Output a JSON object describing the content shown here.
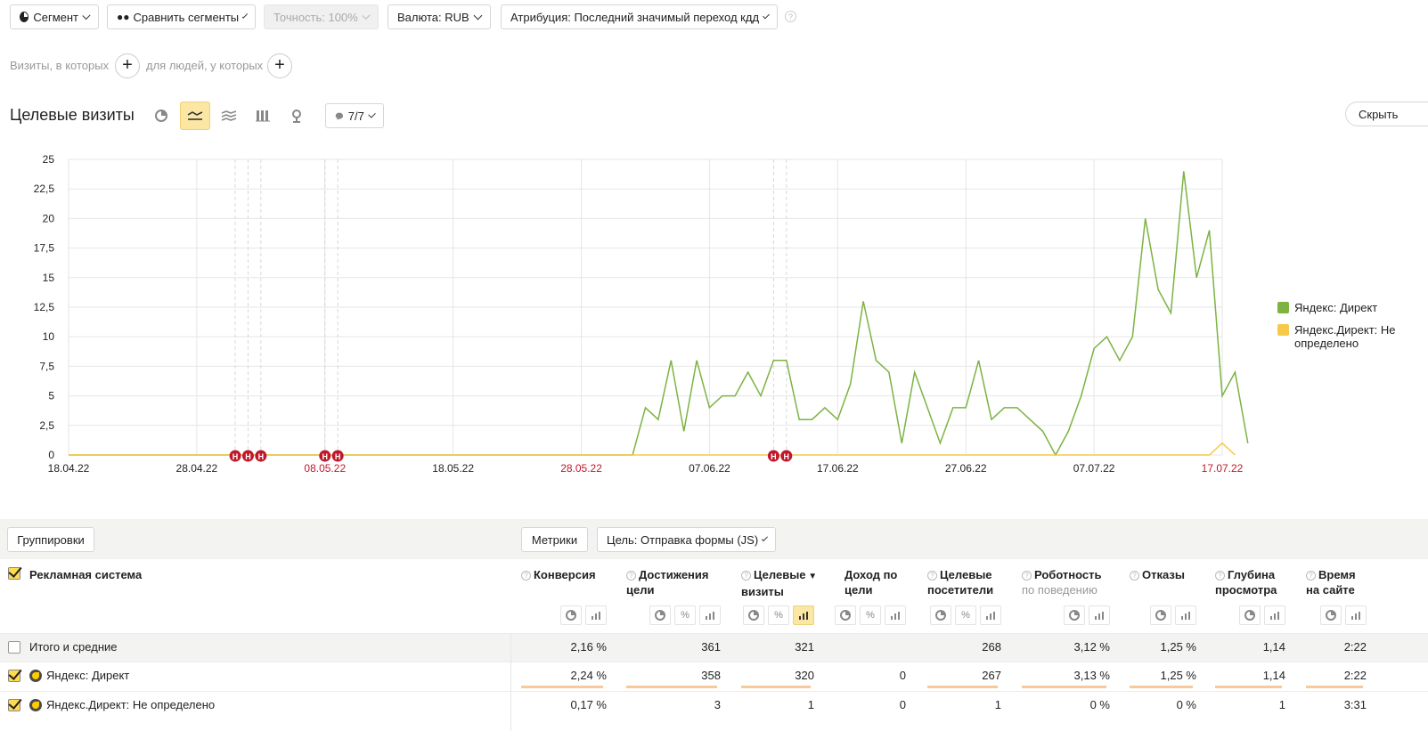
{
  "toolbar": {
    "segment": "Сегмент",
    "compare": "Сравнить сегменты",
    "accuracy": "Точность: 100%",
    "currency": "Валюта: RUB",
    "attribution": "Атрибуция: Последний значимый переход кдд",
    "help": "?"
  },
  "filters": {
    "visits_label": "Визиты, в которых",
    "people_label": "для людей, у которых"
  },
  "report": {
    "title": "Целевые визиты",
    "annotations_label": "7/7",
    "hide_label": "Скрыть"
  },
  "chart_data": {
    "type": "line",
    "x": [
      "18.04.22",
      "19.04.22",
      "20.04.22",
      "21.04.22",
      "22.04.22",
      "23.04.22",
      "24.04.22",
      "25.04.22",
      "26.04.22",
      "27.04.22",
      "28.04.22",
      "29.04.22",
      "30.04.22",
      "01.05.22",
      "02.05.22",
      "03.05.22",
      "04.05.22",
      "05.05.22",
      "06.05.22",
      "07.05.22",
      "08.05.22",
      "09.05.22",
      "10.05.22",
      "11.05.22",
      "12.05.22",
      "13.05.22",
      "14.05.22",
      "15.05.22",
      "16.05.22",
      "17.05.22",
      "18.05.22",
      "19.05.22",
      "20.05.22",
      "21.05.22",
      "22.05.22",
      "23.05.22",
      "24.05.22",
      "25.05.22",
      "26.05.22",
      "27.05.22",
      "28.05.22",
      "29.05.22",
      "30.05.22",
      "31.05.22",
      "01.06.22",
      "02.06.22",
      "03.06.22",
      "04.06.22",
      "05.06.22",
      "06.06.22",
      "07.06.22",
      "08.06.22",
      "09.06.22",
      "10.06.22",
      "11.06.22",
      "12.06.22",
      "13.06.22",
      "14.06.22",
      "15.06.22",
      "16.06.22",
      "17.06.22",
      "18.06.22",
      "19.06.22",
      "20.06.22",
      "21.06.22",
      "22.06.22",
      "23.06.22",
      "24.06.22",
      "25.06.22",
      "26.06.22",
      "27.06.22",
      "28.06.22",
      "29.06.22",
      "30.06.22",
      "01.07.22",
      "02.07.22",
      "03.07.22",
      "04.07.22",
      "05.07.22",
      "06.07.22",
      "07.07.22",
      "08.07.22",
      "09.07.22",
      "10.07.22",
      "11.07.22",
      "12.07.22",
      "13.07.22",
      "14.07.22",
      "15.07.22",
      "16.07.22",
      "17.07.22"
    ],
    "x_ticks": [
      "18.04.22",
      "28.04.22",
      "08.05.22",
      "18.05.22",
      "28.05.22",
      "07.06.22",
      "17.06.22",
      "27.06.22",
      "07.07.22",
      "17.07.22"
    ],
    "x_ticks_red": [
      "08.05.22",
      "28.05.22",
      "17.07.22"
    ],
    "y_ticks": [
      "0",
      "2,5",
      "5",
      "7,5",
      "10",
      "12,5",
      "15",
      "17,5",
      "20",
      "22,5",
      "25"
    ],
    "ylim": [
      0,
      25
    ],
    "grid": true,
    "legend": "right",
    "series": [
      {
        "name": "Яндекс: Директ",
        "color": "#7cb342",
        "values": [
          0,
          0,
          0,
          0,
          0,
          0,
          0,
          0,
          0,
          0,
          0,
          0,
          0,
          0,
          0,
          0,
          0,
          0,
          0,
          0,
          0,
          0,
          0,
          0,
          0,
          0,
          0,
          0,
          0,
          0,
          0,
          0,
          0,
          0,
          0,
          0,
          0,
          0,
          0,
          0,
          0,
          0,
          0,
          0,
          0,
          4,
          3,
          8,
          2,
          8,
          4,
          5,
          5,
          7,
          5,
          8,
          8,
          3,
          3,
          4,
          3,
          6,
          13,
          8,
          7,
          1,
          7,
          4,
          1,
          4,
          4,
          8,
          3,
          4,
          4,
          3,
          2,
          0,
          2,
          5,
          9,
          10,
          8,
          10,
          20,
          14,
          12,
          24,
          15,
          19,
          5,
          7,
          1
        ]
      },
      {
        "name": "Яндекс.Директ: Не определено",
        "color": "#f7c948",
        "values": [
          0,
          0,
          0,
          0,
          0,
          0,
          0,
          0,
          0,
          0,
          0,
          0,
          0,
          0,
          0,
          0,
          0,
          0,
          0,
          0,
          0,
          0,
          0,
          0,
          0,
          0,
          0,
          0,
          0,
          0,
          0,
          0,
          0,
          0,
          0,
          0,
          0,
          0,
          0,
          0,
          0,
          0,
          0,
          0,
          0,
          0,
          0,
          0,
          0,
          0,
          0,
          0,
          0,
          0,
          0,
          0,
          0,
          0,
          0,
          0,
          0,
          0,
          0,
          0,
          0,
          0,
          0,
          0,
          0,
          0,
          0,
          0,
          0,
          0,
          0,
          0,
          0,
          0,
          0,
          0,
          0,
          0,
          0,
          0,
          0,
          0,
          0,
          0,
          0,
          0,
          1,
          0
        ]
      }
    ],
    "annotations": [
      {
        "x": "01.05.22",
        "label": "Н"
      },
      {
        "x": "02.05.22",
        "label": "Н"
      },
      {
        "x": "03.05.22",
        "label": "Н"
      },
      {
        "x": "08.05.22",
        "label": "Н"
      },
      {
        "x": "09.05.22",
        "label": "Н"
      },
      {
        "x": "12.06.22",
        "label": "Н"
      },
      {
        "x": "13.06.22",
        "label": "Н"
      }
    ]
  },
  "table": {
    "groupings_label": "Группировки",
    "metrics_label": "Метрики",
    "goal_label": "Цель: Отправка формы (JS)",
    "dimension_header": "Рекламная система",
    "columns": [
      {
        "l1": "Конверсия",
        "l2": ""
      },
      {
        "l1": "Достижения",
        "l2": "цели"
      },
      {
        "l1": "Целевые",
        "l2": "визиты"
      },
      {
        "l1": "Доход по",
        "l2": "цели"
      },
      {
        "l1": "Целевые",
        "l2": "посетители"
      },
      {
        "l1": "Роботность",
        "l2": "по поведению"
      },
      {
        "l1": "Отказы",
        "l2": ""
      },
      {
        "l1": "Глубина",
        "l2": "просмотра"
      },
      {
        "l1": "Время",
        "l2": "на сайте"
      }
    ],
    "sort_marker": "▼",
    "rows": [
      {
        "name": "Итого и средние",
        "values": [
          "2,16 %",
          "361",
          "321",
          "",
          "268",
          "3,12 %",
          "1,25 %",
          "1,14",
          "2:22"
        ]
      },
      {
        "name": "Яндекс: Директ",
        "values": [
          "2,24 %",
          "358",
          "320",
          "0",
          "267",
          "3,13 %",
          "1,25 %",
          "1,14",
          "2:22"
        ]
      },
      {
        "name": "Яндекс.Директ: Не определено",
        "values": [
          "0,17 %",
          "3",
          "1",
          "0",
          "1",
          "0 %",
          "0 %",
          "1",
          "3:31"
        ]
      }
    ]
  }
}
